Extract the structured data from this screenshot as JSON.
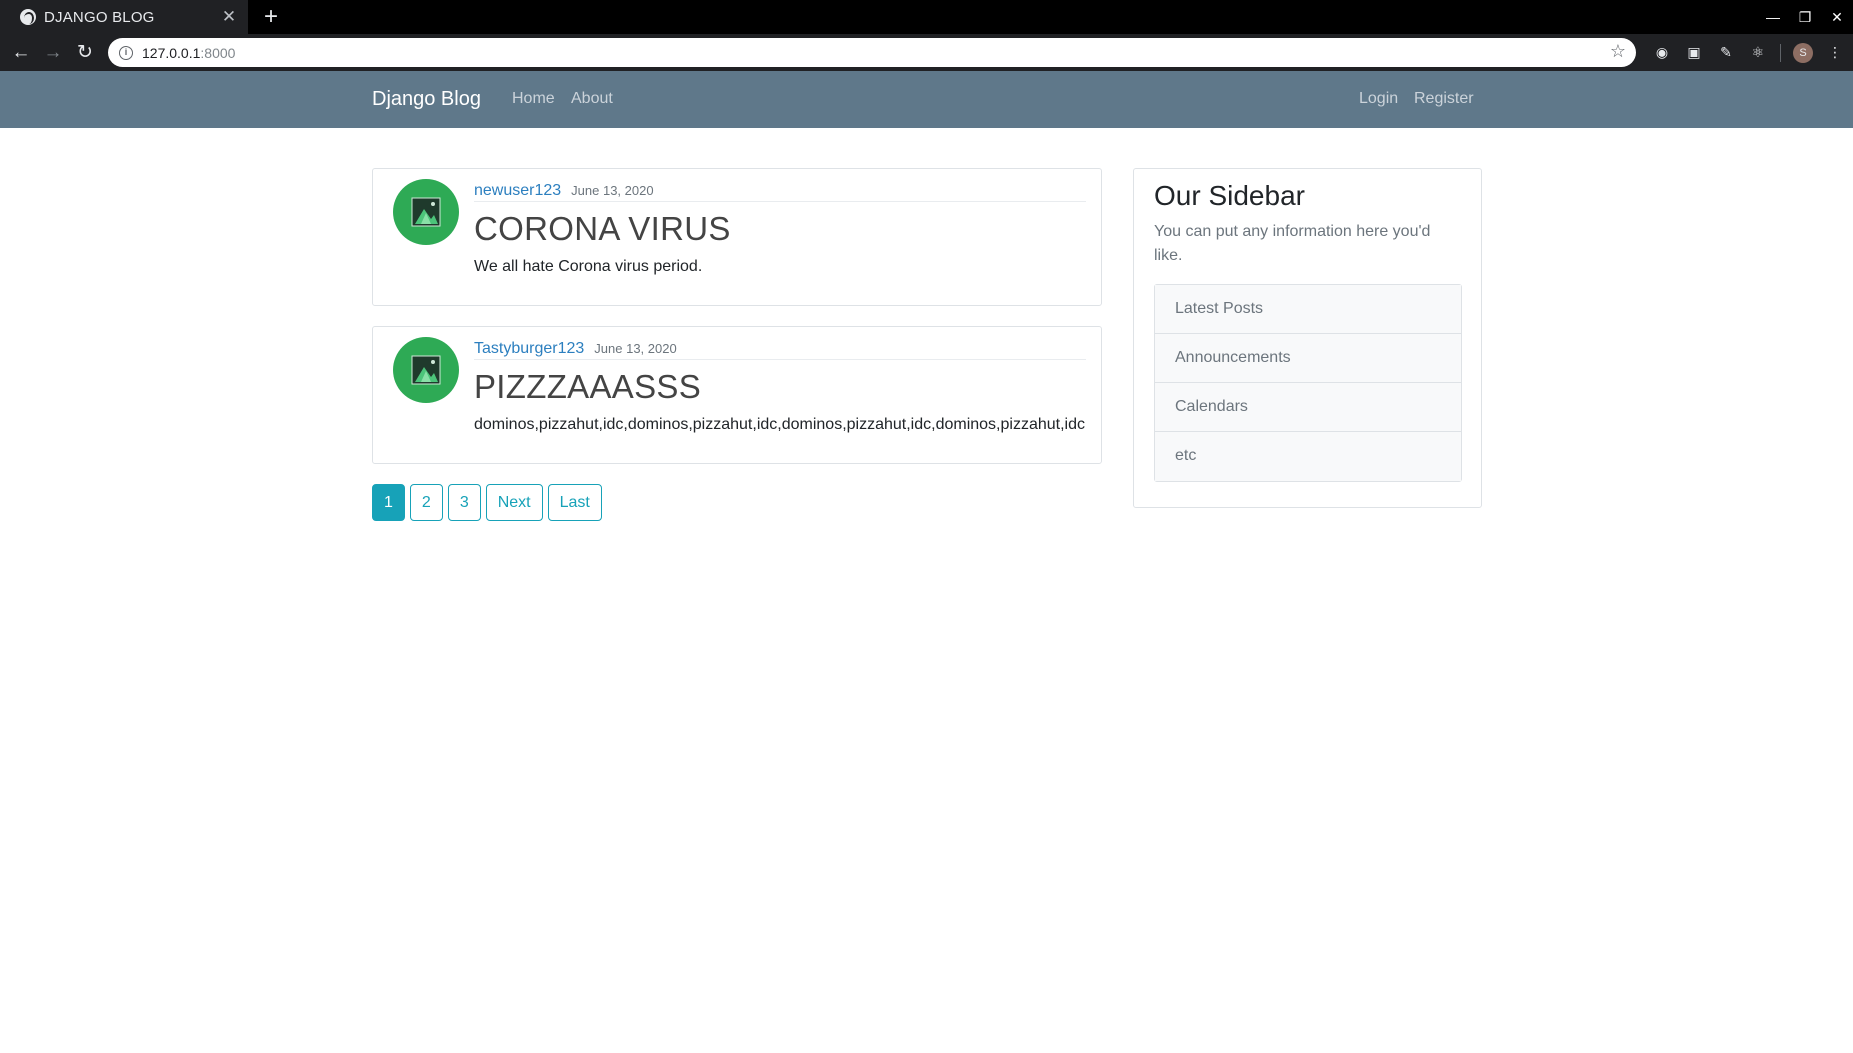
{
  "browser": {
    "tab_title": "DJANGO BLOG",
    "tab_close": "✕",
    "new_tab": "+",
    "url_host": "127.0.0.1",
    "url_port": ":8000",
    "profile_initial": "S"
  },
  "navbar": {
    "brand": "Django Blog",
    "links": [
      "Home",
      "About"
    ],
    "auth_links": [
      "Login",
      "Register"
    ],
    "background": "#5f788a"
  },
  "posts": [
    {
      "author": "newuser123",
      "date": "June 13, 2020",
      "title": "CORONA VIRUS",
      "body": "We all hate Corona virus period."
    },
    {
      "author": "Tastyburger123",
      "date": "June 13, 2020",
      "title": "PIZZZAAASSS",
      "body": "dominos,pizzahut,idc,dominos,pizzahut,idc,dominos,pizzahut,idc,dominos,pizzahut,idc"
    }
  ],
  "pagination": {
    "pages": [
      "1",
      "2",
      "3"
    ],
    "current": "1",
    "next_label": "Next",
    "last_label": "Last",
    "accent": "#17a2b8"
  },
  "sidebar": {
    "title": "Our Sidebar",
    "text": "You can put any information here you'd like.",
    "items": [
      "Latest Posts",
      "Announcements",
      "Calendars",
      "etc"
    ]
  },
  "colors": {
    "link": "#2c7fbf",
    "avatar_bg": "#2eaa55"
  }
}
